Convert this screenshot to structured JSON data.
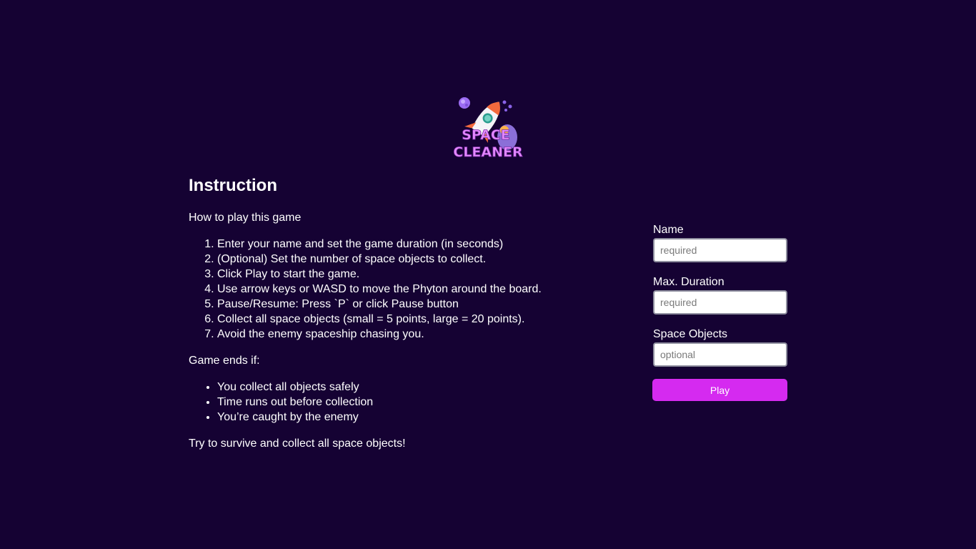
{
  "logo": {
    "line1": "SPACE",
    "line2": "CLEANER"
  },
  "instructions": {
    "title": "Instruction",
    "intro": "How to play this game",
    "steps": [
      "Enter your name and set the game duration (in seconds)",
      "(Optional) Set the number of space objects to collect.",
      "Click Play to start the game.",
      "Use arrow keys or WASD to move the Phyton around the board.",
      "Pause/Resume: Press `P` or click Pause button",
      "Collect all space objects (small = 5 points, large = 20 points).",
      "Avoid the enemy spaceship chasing you."
    ],
    "ends_title": "Game ends if:",
    "ends": [
      "You collect all objects safely",
      "Time runs out before collection",
      "You’re caught by the enemy"
    ],
    "outro": "Try to survive and collect all space objects!"
  },
  "form": {
    "name": {
      "label": "Name",
      "placeholder": "required",
      "value": ""
    },
    "duration": {
      "label": "Max. Duration",
      "placeholder": "required",
      "value": ""
    },
    "objects": {
      "label": "Space Objects",
      "placeholder": "optional",
      "value": ""
    },
    "play_label": "Play"
  },
  "colors": {
    "background": "#150233",
    "accent": "#d52af0",
    "logo_text": "#e58cff"
  },
  "icons": {
    "logo": "rocket-logo-icon"
  }
}
